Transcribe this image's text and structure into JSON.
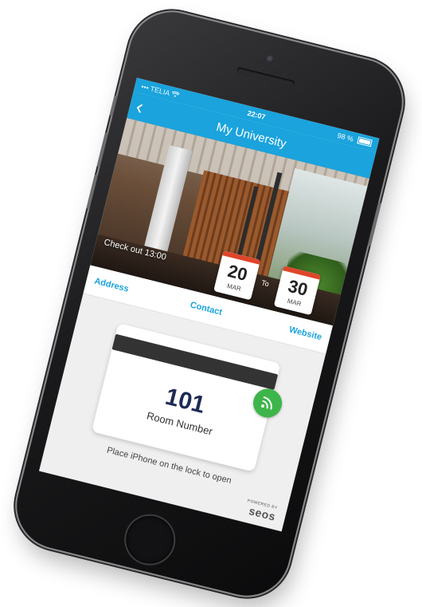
{
  "status_bar": {
    "carrier": "TELIA",
    "time": "22:07",
    "battery": "98 %"
  },
  "nav": {
    "back_glyph": "‹",
    "title": "My University"
  },
  "hero": {
    "checkout_text": "Check out 13:00",
    "date_from": {
      "day": "20",
      "month": "MAR"
    },
    "date_to_label": "To",
    "date_to": {
      "day": "30",
      "month": "MAR"
    }
  },
  "tabs": {
    "address": "Address",
    "contact": "Contact",
    "website": "Website"
  },
  "key": {
    "room_number": "101",
    "room_label": "Room Number",
    "hint": "Place iPhone on the lock to open"
  },
  "footer": {
    "powered_by": "POWERED BY",
    "brand": "seos"
  },
  "colors": {
    "accent": "#1aa3dc",
    "nfc_green": "#3db54a",
    "room_number": "#1d2b55",
    "calendar_red": "#e0452a"
  },
  "icons": {
    "back": "chevron-left-icon",
    "nfc": "wireless-signal-icon",
    "wifi": "wifi-icon",
    "battery": "battery-icon"
  }
}
